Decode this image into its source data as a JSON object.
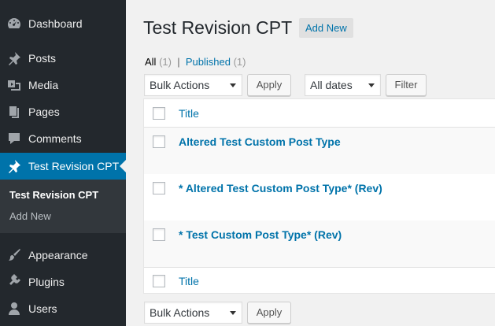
{
  "sidebar": {
    "items": [
      {
        "label": "Dashboard",
        "icon": "dashboard-icon"
      },
      {
        "label": "Posts",
        "icon": "pin-icon"
      },
      {
        "label": "Media",
        "icon": "media-icon"
      },
      {
        "label": "Pages",
        "icon": "pages-icon"
      },
      {
        "label": "Comments",
        "icon": "comment-icon"
      },
      {
        "label": "Test Revision CPT",
        "icon": "pin-icon"
      },
      {
        "label": "Appearance",
        "icon": "paintbrush-icon"
      },
      {
        "label": "Plugins",
        "icon": "plug-icon"
      },
      {
        "label": "Users",
        "icon": "user-icon"
      }
    ],
    "submenu": {
      "active": "Test Revision CPT",
      "add_new": "Add New"
    },
    "colors": {
      "background": "#23282d",
      "current": "#0073aa",
      "submenu": "#32373c"
    }
  },
  "header": {
    "title": "Test Revision CPT",
    "add_new": "Add New"
  },
  "filters": {
    "all_label": "All",
    "all_count": "(1)",
    "separator": "|",
    "published_label": "Published",
    "published_count": "(1)"
  },
  "tablenav_top": {
    "bulk_actions": "Bulk Actions",
    "apply": "Apply",
    "dates": "All dates",
    "filter": "Filter"
  },
  "table": {
    "column_title": "Title",
    "rows": [
      {
        "title": "Altered Test Custom Post Type"
      },
      {
        "title": "* Altered Test Custom Post Type* (Rev)"
      },
      {
        "title": "* Test Custom Post Type* (Rev)"
      }
    ],
    "footer_title": "Title"
  },
  "tablenav_bottom": {
    "bulk_actions": "Bulk Actions",
    "apply": "Apply"
  }
}
